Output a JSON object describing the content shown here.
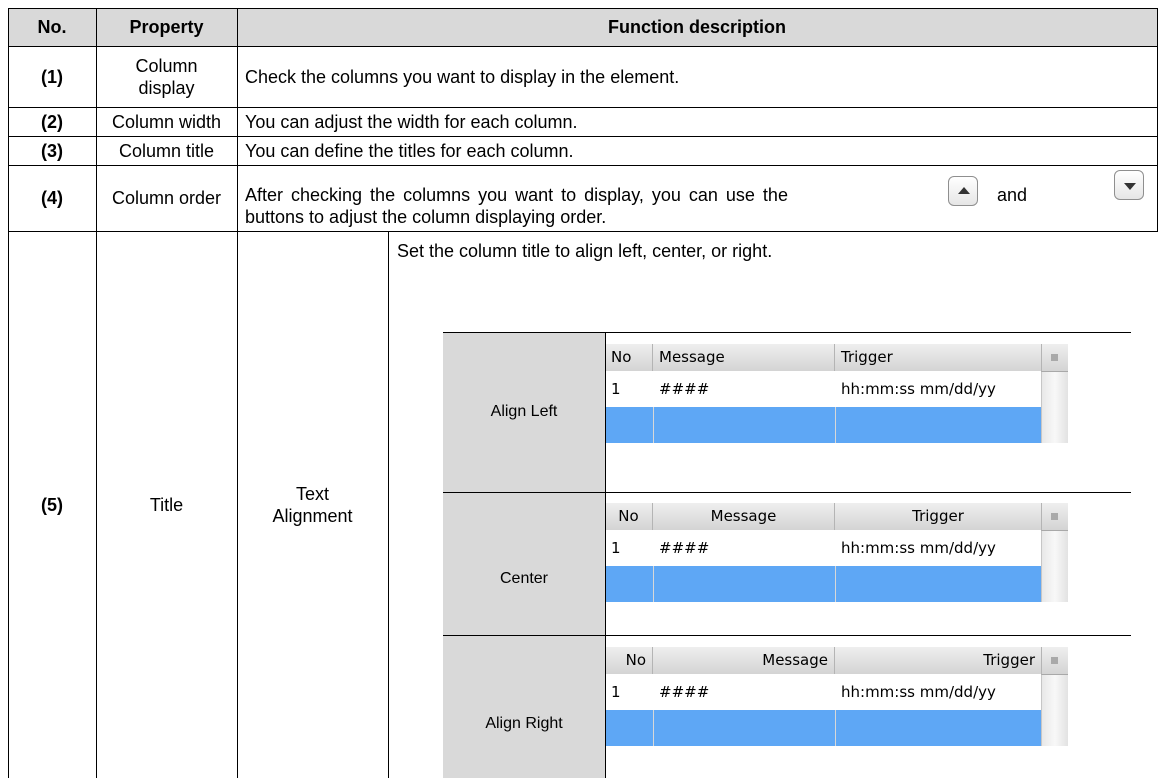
{
  "table": {
    "headers": {
      "no": "No.",
      "property": "Property",
      "description": "Function description"
    },
    "rows": [
      {
        "no": "(1)",
        "property": "Column display",
        "description": "Check the columns you want to display in the element."
      },
      {
        "no": "(2)",
        "property": "Column width",
        "description": "You can adjust the width for each column."
      },
      {
        "no": "(3)",
        "property": "Column title",
        "description": "You can define the titles for each column."
      },
      {
        "no": "(4)",
        "property": "Column order",
        "description_part1": "After checking the columns you want to display, you can use the",
        "description_and": "and",
        "description_part2": "buttons to adjust the column displaying order."
      },
      {
        "no": "(5)",
        "property": "Title",
        "subproperty": "Text Alignment",
        "description": "Set the column title to align left, center, or right."
      }
    ]
  },
  "icons": {
    "up_button": "triangle-up-icon",
    "down_button": "triangle-down-icon",
    "list_corner": "square-icon"
  },
  "alignment_examples": [
    {
      "label": "Align Left",
      "columns": [
        "No",
        "Message",
        "Trigger"
      ],
      "row": [
        "1",
        "####",
        "hh:mm:ss mm/dd/yy"
      ],
      "header_align": "left"
    },
    {
      "label": "Center",
      "columns": [
        "No",
        "Message",
        "Trigger"
      ],
      "row": [
        "1",
        "####",
        "hh:mm:ss mm/dd/yy"
      ],
      "header_align": "center"
    },
    {
      "label": "Align Right",
      "columns": [
        "No",
        "Message",
        "Trigger"
      ],
      "row": [
        "1",
        "####",
        "hh:mm:ss mm/dd/yy"
      ],
      "header_align": "right"
    }
  ],
  "colors": {
    "header_bg": "#d9d9d9",
    "selected_row": "#5ea7f5"
  }
}
